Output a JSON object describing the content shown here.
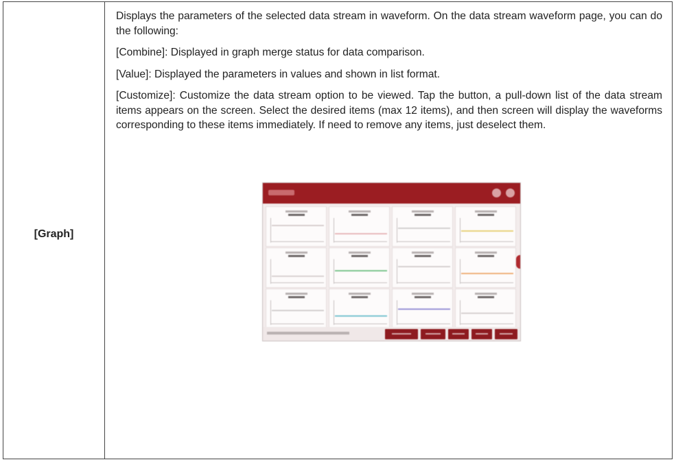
{
  "row": {
    "label": "[Graph]",
    "paragraphs": [
      "Displays the parameters of the selected data stream in waveform. On the data stream waveform page, you can do the following:",
      "[Combine]: Displayed in graph merge status for data comparison.",
      "[Value]: Displayed the parameters in values and shown in list format.",
      "[Customize]: Customize the data stream option to be viewed. Tap the button, a pull-down list of the data stream items appears on the screen. Select the desired items (max 12 items), and then screen will display the waveforms corresponding to these items immediately. If need to remove any items, just deselect them."
    ]
  },
  "screenshot": {
    "header_color": "#9b1d22",
    "wave_colors": [
      "#d8cfcf",
      "#e8b9bb",
      "#d4d0d0",
      "#e8d27a",
      "#d9d2d2",
      "#7cc48e",
      "#d6d0d0",
      "#f0b07a",
      "#d3cfcf",
      "#79c3cf",
      "#9a93d6",
      "#d7d1d1"
    ]
  }
}
